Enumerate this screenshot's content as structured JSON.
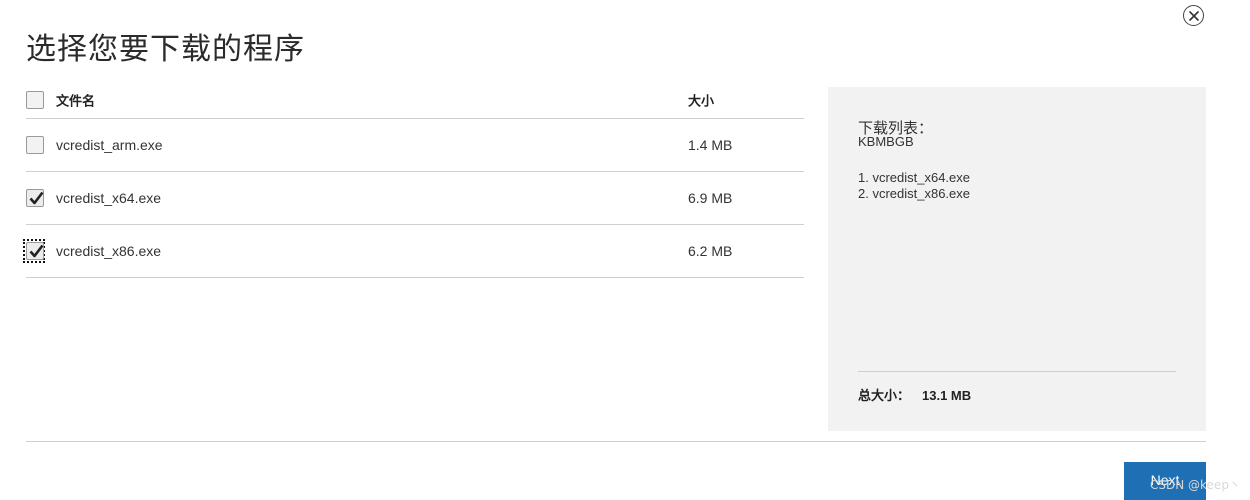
{
  "dialog": {
    "title": "选择您要下载的程序"
  },
  "table": {
    "header": {
      "name": "文件名",
      "size": "大小",
      "checked": false
    },
    "rows": [
      {
        "name": "vcredist_arm.exe",
        "size": "1.4 MB",
        "checked": false
      },
      {
        "name": "vcredist_x64.exe",
        "size": "6.9 MB",
        "checked": true
      },
      {
        "name": "vcredist_x86.exe",
        "size": "6.2 MB",
        "checked": true,
        "focused": true
      }
    ]
  },
  "side_panel": {
    "heading": "下载列表：",
    "sub": "KBMBGB",
    "items": [
      "1. vcredist_x64.exe",
      "2. vcredist_x86.exe"
    ],
    "total_label": "总大小：",
    "total_value": "13.1 MB"
  },
  "footer": {
    "next_label": "Next",
    "watermark": "CSDN @keep丶"
  },
  "icons": {
    "close": "close-circle-icon",
    "check": "checkmark-icon"
  },
  "colors": {
    "accent": "#1f6fb5",
    "panel_bg": "#f2f2f2",
    "divider": "#cfcfcf"
  }
}
